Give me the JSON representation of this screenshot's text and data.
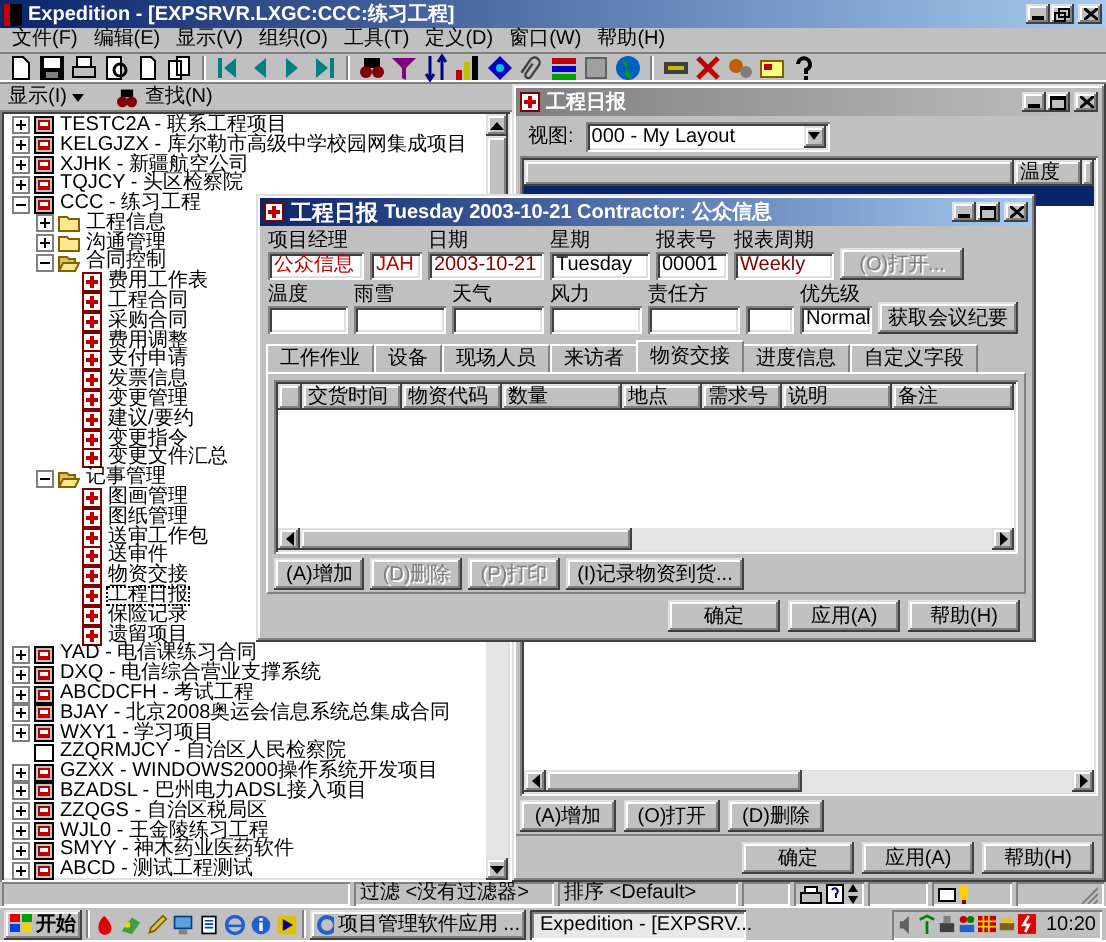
{
  "window": {
    "title": "Expedition - [EXPSRVR.LXGC:CCC:练习工程]"
  },
  "menu": [
    "文件(F)",
    "编辑(E)",
    "显示(V)",
    "组织(O)",
    "工具(T)",
    "定义(D)",
    "窗口(W)",
    "帮助(H)"
  ],
  "left_panel": {
    "display_menu": "显示(I)",
    "find_button": "查找(N)"
  },
  "tree": [
    {
      "label": "TESTC2A - 联系工程项目",
      "kind": "project",
      "expanded": false,
      "selected": false
    },
    {
      "label": "KELGJZX - 库尔勒市高级中学校园网集成项目",
      "kind": "project",
      "expanded": false,
      "selected": false
    },
    {
      "label": "XJHK - 新疆航空公司",
      "kind": "project",
      "expanded": false,
      "selected": false
    },
    {
      "label": "TQJCY - 头区检察院",
      "kind": "project",
      "expanded": false,
      "selected": false
    },
    {
      "label": "CCC - 练习工程",
      "kind": "project",
      "expanded": true,
      "selected": false,
      "children": [
        {
          "label": "工程信息",
          "kind": "folder",
          "expanded": false,
          "selected": false
        },
        {
          "label": "沟通管理",
          "kind": "folder",
          "expanded": false,
          "selected": false
        },
        {
          "label": "合同控制",
          "kind": "folder",
          "expanded": true,
          "selected": false,
          "children": [
            {
              "label": "费用工作表",
              "kind": "form",
              "selected": false
            },
            {
              "label": "工程合同",
              "kind": "form",
              "selected": false
            },
            {
              "label": "采购合同",
              "kind": "form",
              "selected": false
            },
            {
              "label": "费用调整",
              "kind": "form",
              "selected": false
            },
            {
              "label": "支付申请",
              "kind": "form",
              "selected": false
            },
            {
              "label": "发票信息",
              "kind": "form",
              "selected": false
            },
            {
              "label": "变更管理",
              "kind": "form",
              "selected": false
            },
            {
              "label": "建议/要约",
              "kind": "form",
              "selected": false
            },
            {
              "label": "变更指令",
              "kind": "form",
              "selected": false
            },
            {
              "label": "变更文件汇总",
              "kind": "form",
              "selected": false
            }
          ]
        },
        {
          "label": "记事管理",
          "kind": "folder",
          "expanded": true,
          "selected": false,
          "children": [
            {
              "label": "图画管理",
              "kind": "form",
              "selected": false
            },
            {
              "label": "图纸管理",
              "kind": "form",
              "selected": false
            },
            {
              "label": "送审工作包",
              "kind": "form",
              "selected": false
            },
            {
              "label": "送审件",
              "kind": "form",
              "selected": false
            },
            {
              "label": "物资交接",
              "kind": "form",
              "selected": false
            },
            {
              "label": "工程日报",
              "kind": "form",
              "selected": true
            },
            {
              "label": "保险记录",
              "kind": "form",
              "selected": false
            },
            {
              "label": "遗留项目",
              "kind": "form",
              "selected": false
            }
          ]
        }
      ]
    },
    {
      "label": "YAD - 电信课练习合同",
      "kind": "project",
      "expanded": false,
      "selected": false
    },
    {
      "label": "DXQ - 电信综合营业支撑系统",
      "kind": "project",
      "expanded": false,
      "selected": false
    },
    {
      "label": "ABCDCFH - 考试工程",
      "kind": "project",
      "expanded": false,
      "selected": false
    },
    {
      "label": "BJAY - 北京2008奥运会信息系统总集成合同",
      "kind": "project",
      "expanded": false,
      "selected": false
    },
    {
      "label": "WXY1 - 学习项目",
      "kind": "project",
      "expanded": false,
      "selected": false
    },
    {
      "label": "ZZQRMJCY - 自治区人民检察院",
      "kind": "blank",
      "selected": false
    },
    {
      "label": "GZXX - WINDOWS2000操作系统开发项目",
      "kind": "project",
      "expanded": false,
      "selected": false
    },
    {
      "label": "BZADSL - 巴州电力ADSL接入项目",
      "kind": "project",
      "expanded": false,
      "selected": false
    },
    {
      "label": "ZZQGS - 自治区税局区",
      "kind": "project",
      "expanded": false,
      "selected": false
    },
    {
      "label": "WJL0 - 王金陵练习工程",
      "kind": "project",
      "expanded": false,
      "selected": false
    },
    {
      "label": "SMYY - 神木药业医药软件",
      "kind": "project",
      "expanded": false,
      "selected": false
    },
    {
      "label": "ABCD - 测试工程测试",
      "kind": "project",
      "expanded": false,
      "selected": false
    }
  ],
  "child_window": {
    "title": "工程日报",
    "view_label": "视图:",
    "view_value": "000 - My Layout",
    "grid": {
      "columns": [
        "温度"
      ],
      "rows": [
        {
          "selected": true
        }
      ]
    },
    "buttons": [
      "(A)增加",
      "(O)打开",
      "(D)删除"
    ],
    "footer_buttons": [
      "确定",
      "应用(A)",
      "帮助(H)"
    ]
  },
  "dialog": {
    "title": "工程日报",
    "subtitle": "Tuesday 2003-10-21 Contractor: 公众信息",
    "form_rows": [
      [
        {
          "kind": "field",
          "label": "项目经理",
          "value": "公众信息",
          "color": "#c00000"
        },
        {
          "kind": "field",
          "value": "JAH",
          "color": "#c00000"
        },
        {
          "kind": "field",
          "label": "日期",
          "value": "2003-10-21",
          "color": "#800000"
        },
        {
          "kind": "field",
          "label": "星期",
          "value": "Tuesday",
          "color": "#000000"
        },
        {
          "kind": "field",
          "label": "报表号",
          "value": "00001",
          "color": "#000000"
        },
        {
          "kind": "field",
          "label": "报表周期",
          "value": "Weekly",
          "color": "#800000"
        },
        {
          "kind": "button",
          "label": "(O)打开...",
          "disabled": true
        }
      ],
      [
        {
          "kind": "field",
          "label": "温度"
        },
        {
          "kind": "field",
          "label": "雨雪"
        },
        {
          "kind": "field",
          "label": "天气"
        },
        {
          "kind": "field",
          "label": "风力"
        },
        {
          "kind": "field",
          "label": "责任方"
        },
        {
          "kind": "field"
        },
        {
          "kind": "field",
          "label": "优先级",
          "value": "Normal",
          "color": "#000000"
        },
        {
          "kind": "button",
          "label": "获取会议纪要",
          "disabled": false
        }
      ]
    ],
    "tabs": [
      {
        "label": "工作作业",
        "selected": false
      },
      {
        "label": "设备",
        "selected": false
      },
      {
        "label": "现场人员",
        "selected": false
      },
      {
        "label": "来访者",
        "selected": false
      },
      {
        "label": "物资交接",
        "selected": true
      },
      {
        "label": "进度信息",
        "selected": false
      },
      {
        "label": "自定义字段",
        "selected": false
      }
    ],
    "grid_columns": [
      "交货时间",
      "物资代码",
      "数量",
      "地点",
      "需求号",
      "说明",
      "备注"
    ],
    "grid_buttons": [
      {
        "label": "(A)增加",
        "disabled": false
      },
      {
        "label": "(D)删除",
        "disabled": true
      },
      {
        "label": "(P)打印",
        "disabled": true
      },
      {
        "label": "(I)记录物资到货...",
        "disabled": false
      }
    ],
    "footer_buttons": [
      "确定",
      "应用(A)",
      "帮助(H)"
    ]
  },
  "status_bar": [
    "过滤 <没有过滤器>",
    "排序 <Default>"
  ],
  "taskbar": {
    "start": "开始",
    "tasks": [
      {
        "label": "项目管理软件应用 ...",
        "selected": false
      },
      {
        "label": "Expedition - [EXPSRV...",
        "selected": true
      }
    ],
    "clock": "10:20"
  }
}
